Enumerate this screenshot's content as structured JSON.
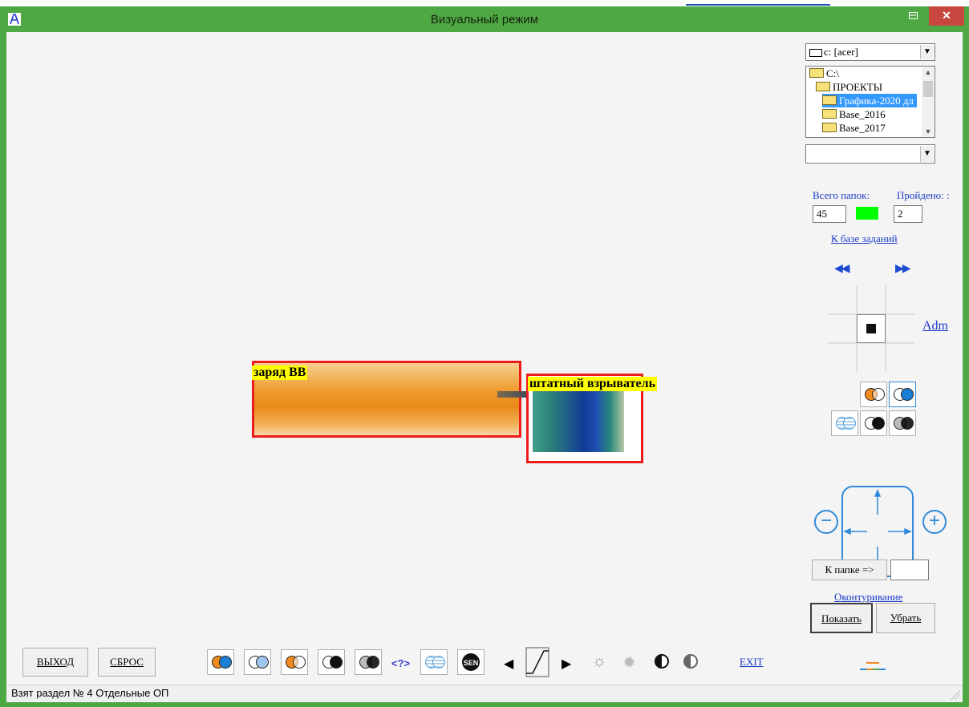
{
  "window": {
    "title": "Визуальный режим"
  },
  "scene": {
    "charge_label": "заряд ВВ",
    "fuse_label": "штатный взрыватель"
  },
  "right_panel": {
    "drive": "c: [acer]",
    "folders": [
      {
        "name": "C:\\",
        "level": 0,
        "open": true,
        "selected": false
      },
      {
        "name": "ПРОЕКТЫ",
        "level": 1,
        "open": true,
        "selected": false
      },
      {
        "name": "Графика-2020 дл",
        "level": 2,
        "open": true,
        "selected": true
      },
      {
        "name": "Base_2016",
        "level": 2,
        "open": false,
        "selected": false
      },
      {
        "name": "Base_2017",
        "level": 2,
        "open": false,
        "selected": false
      }
    ],
    "total_folders_label": "Всего папок:",
    "passed_label": "Пройдено: :",
    "total_folders_value": "45",
    "passed_value": "2",
    "task_base_link": "К базе заданий",
    "adm_link": "Adm",
    "to_folder_button": "К папке  =>",
    "to_folder_value": "",
    "contouring_link": "Оконтуривание",
    "show_button": "Показать",
    "remove_button": "Убрать"
  },
  "bottom_bar": {
    "exit_button": "ВЫХОД",
    "reset_button": "СБРОС",
    "help_label": "<?>",
    "exit_link": "EXIT"
  },
  "status": {
    "text": "Взят раздел № 4 Отдельные ОП"
  },
  "colors": {
    "titlebar": "#4ea843",
    "close_button": "#c7463d",
    "highlight": "#ee1b1b",
    "label_bg": "#ffff00",
    "link": "#1c3cc9",
    "nav_accent": "#2f8ad8",
    "progress": "#00ff00"
  }
}
